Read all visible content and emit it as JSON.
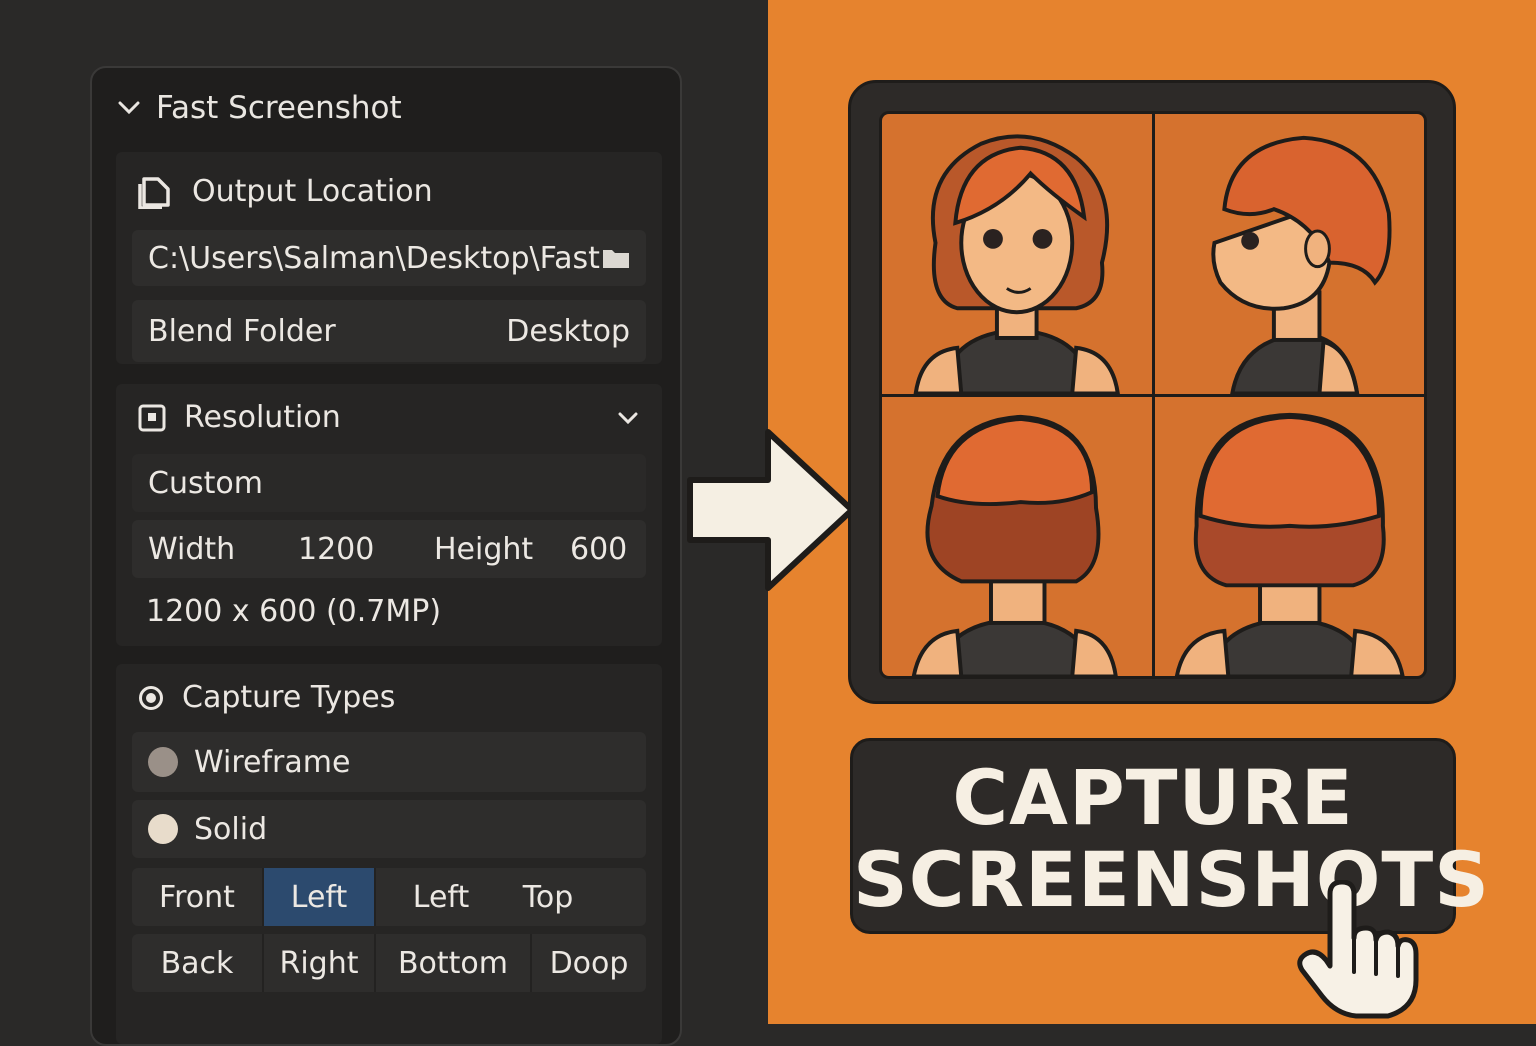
{
  "panel": {
    "title": "Fast Screenshot",
    "output": {
      "title": "Output Location",
      "path": "C:\\Users\\Salman\\Desktop\\Fast",
      "blend_label": "Blend Folder",
      "blend_value": "Desktop"
    },
    "resolution": {
      "title": "Resolution",
      "preset": "Custom",
      "width_label": "Width",
      "width_value": "1200",
      "height_label": "Height",
      "height_value": "600",
      "summary": "1200 x 600 (0.7MP)"
    },
    "capture": {
      "title": "Capture Types",
      "wireframe": "Wireframe",
      "solid": "Solid",
      "row1": [
        "Front",
        "Left",
        "Left",
        "Top"
      ],
      "row2": [
        "Back",
        "Right",
        "Bottom",
        "Doop"
      ]
    }
  },
  "cta": {
    "line1": "CAPTURE",
    "line2": "SCREENSHOTS"
  },
  "colors": {
    "left_bg": "#2a2928",
    "right_bg": "#e6832e",
    "active_button": "#2c4a6e",
    "cta_text": "#f6efe3"
  },
  "icons": [
    "chevron-down-icon",
    "file-icon",
    "folder-icon",
    "resolution-icon",
    "radio-icon",
    "pointer-hand-icon",
    "arrow-right-icon"
  ]
}
